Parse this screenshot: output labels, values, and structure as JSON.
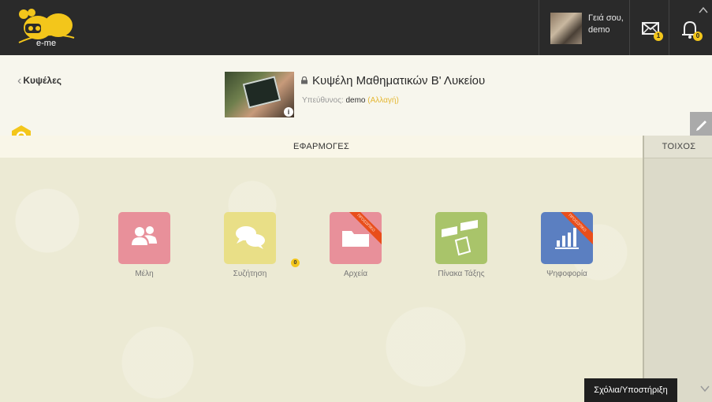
{
  "topbar": {
    "logo_text": "e-me",
    "user_greeting": "Γειά σου,",
    "user_name": "demo",
    "messages_badge": "1",
    "notifications_badge": "0"
  },
  "header": {
    "back_label": "Κυψέλες",
    "class_title": "Κυψέλη Μαθηματικών Β' Λυκείου",
    "owner_label": "Υπεύθυνος:",
    "owner_name": "demo",
    "owner_change": "(Αλλαγή)"
  },
  "apps_section": {
    "title": "ΕΦΑΡΜΟΓΕΣ",
    "apps": [
      {
        "label": "Μέλη",
        "color": "#e8909a",
        "icon": "members-icon",
        "ribbon": ""
      },
      {
        "label": "Συζήτηση",
        "color": "#e9df87",
        "icon": "discussion-icon",
        "ribbon": "",
        "badge": "0"
      },
      {
        "label": "Αρχεία",
        "color": "#e8909a",
        "icon": "folder-icon",
        "ribbon": "ΠΡΟΣΩΠΙΚΟ"
      },
      {
        "label": "Πίνακα Τάξης",
        "color": "#a9c46a",
        "icon": "classboard-icon",
        "ribbon": ""
      },
      {
        "label": "Ψηφοφορία",
        "color": "#5b7fc1",
        "icon": "poll-icon",
        "ribbon": "ΠΡΟΣΩΠΙΚΟ"
      }
    ]
  },
  "wall": {
    "title": "ΤΟΙΧΟΣ"
  },
  "footer": {
    "feedback_label": "Σχόλια/Υποστήριξη"
  }
}
